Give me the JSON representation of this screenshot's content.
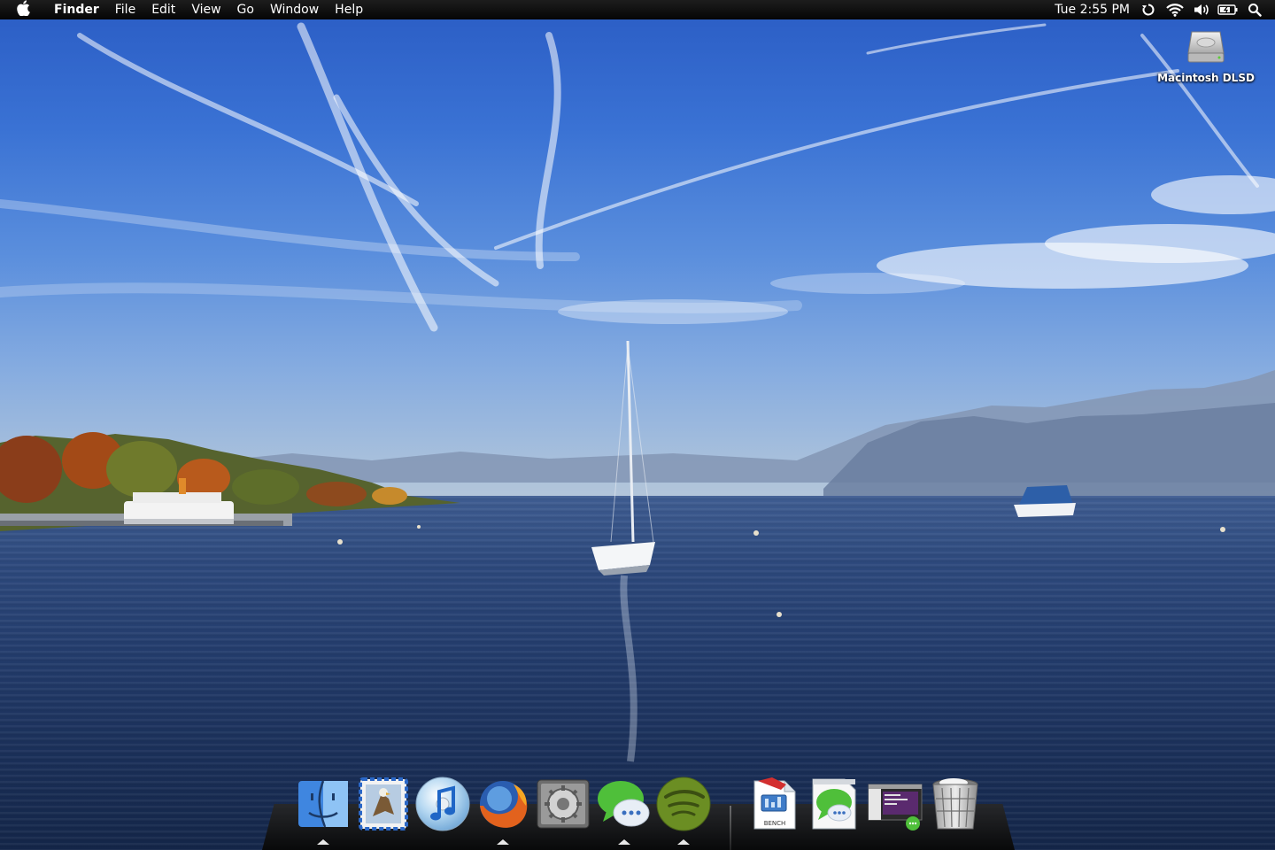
{
  "menubar": {
    "apple_icon": "apple-logo-icon",
    "app_name": "Finder",
    "menus": [
      "File",
      "Edit",
      "View",
      "Go",
      "Window",
      "Help"
    ],
    "clock": "Tue 2:55 PM",
    "status_icons": [
      "time-machine-icon",
      "wifi-icon",
      "volume-icon",
      "battery-icon",
      "spotlight-icon"
    ]
  },
  "desktop": {
    "icons": [
      {
        "label": "Macintosh DLSD",
        "icon": "hard-drive-icon"
      }
    ]
  },
  "dock": {
    "apps": [
      {
        "name": "Finder",
        "icon": "finder-icon",
        "running": true
      },
      {
        "name": "Mail",
        "icon": "mail-icon",
        "running": false
      },
      {
        "name": "iTunes",
        "icon": "itunes-icon",
        "running": false
      },
      {
        "name": "Firefox",
        "icon": "firefox-icon",
        "running": true
      },
      {
        "name": "System Preferences",
        "icon": "system-preferences-icon",
        "running": false
      },
      {
        "name": "Messages",
        "icon": "messages-icon",
        "running": true
      },
      {
        "name": "Spotify",
        "icon": "spotify-icon",
        "running": true
      }
    ],
    "others": [
      {
        "name": "Bench",
        "icon": "bench-document-icon",
        "label": "BENCH"
      },
      {
        "name": "Messages",
        "icon": "messages-document-icon"
      },
      {
        "name": "Terminal",
        "icon": "terminal-screenshot-icon"
      },
      {
        "name": "Trash",
        "icon": "trash-icon"
      }
    ]
  }
}
